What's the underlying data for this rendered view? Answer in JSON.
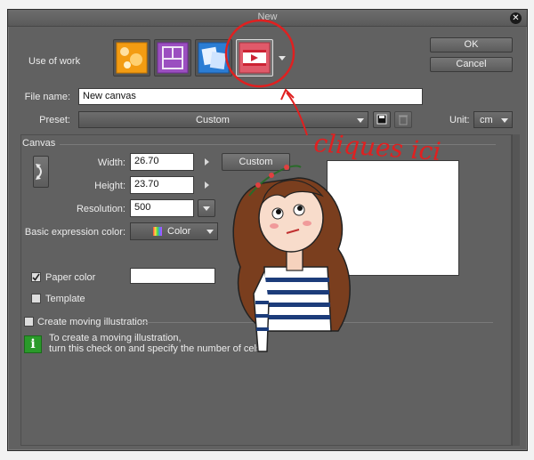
{
  "window": {
    "title": "New"
  },
  "buttons": {
    "ok": "OK",
    "cancel": "Cancel"
  },
  "use_of_work": {
    "label": "Use of work",
    "options": [
      {
        "name": "illustration",
        "icon": "illustration-icon",
        "color": "#f0a020"
      },
      {
        "name": "comic",
        "icon": "comic-page-icon",
        "color": "#a050c8"
      },
      {
        "name": "show-all-settings",
        "icon": "all-settings-icon",
        "color": "#2e7fd0"
      },
      {
        "name": "animation",
        "icon": "film-icon",
        "color": "#e05060"
      }
    ]
  },
  "file_name": {
    "label": "File name:",
    "value": "New canvas"
  },
  "preset": {
    "label": "Preset:",
    "value": "Custom"
  },
  "unit": {
    "label": "Unit:",
    "value": "cm"
  },
  "canvas": {
    "section_label": "Canvas",
    "width_label": "Width:",
    "width_value": "26.70",
    "height_label": "Height:",
    "height_value": "23.70",
    "resolution_label": "Resolution:",
    "resolution_value": "500",
    "size_preset_button": "Custom",
    "expression_color_label": "Basic expression color:",
    "expression_color_value": "Color",
    "paper_color_label": "Paper color",
    "paper_color_checked": true,
    "template_label": "Template",
    "template_checked": false
  },
  "moving_illustration": {
    "label": "Create moving illustration",
    "checked": false,
    "info_line1": "To create a moving illustration,",
    "info_line2": "turn this check on and specify the number of cels."
  },
  "annotation": {
    "text": "cliques ici",
    "color": "#e02020"
  }
}
